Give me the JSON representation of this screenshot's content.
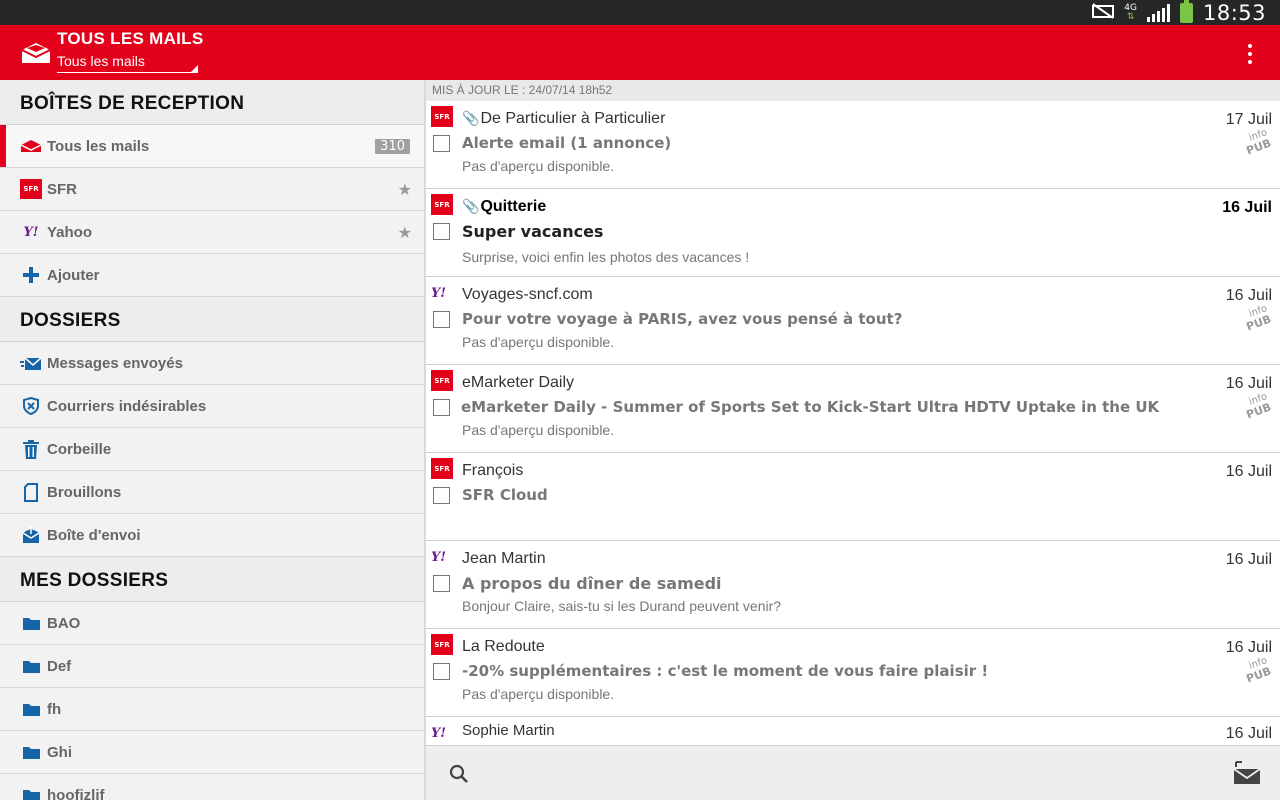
{
  "status": {
    "time": "18:53",
    "network": "4G"
  },
  "header": {
    "title": "TOUS LES MAILS",
    "subtitle": "Tous les mails"
  },
  "sidebar": {
    "inbox_title": "BOÎTES DE RECEPTION",
    "inbox_items": [
      {
        "label": "Tous les mails",
        "count": "310"
      },
      {
        "label": "SFR",
        "logo": "SFR"
      },
      {
        "label": "Yahoo",
        "logo": "Y!"
      },
      {
        "label": "Ajouter"
      }
    ],
    "folders_title": "DOSSIERS",
    "folders": [
      {
        "label": "Messages envoyés"
      },
      {
        "label": "Courriers indésirables"
      },
      {
        "label": "Corbeille"
      },
      {
        "label": "Brouillons"
      },
      {
        "label": "Boîte d'envoi"
      }
    ],
    "my_folders_title": "MES DOSSIERS",
    "my_folders": [
      {
        "label": "BAO"
      },
      {
        "label": "Def"
      },
      {
        "label": "fh"
      },
      {
        "label": "Ghi"
      },
      {
        "label": "hoofizlif"
      }
    ]
  },
  "list": {
    "updated": "MIS À JOUR LE : 24/07/14 18h52",
    "pub_info": "info",
    "pub_label": "PUB",
    "messages": [
      {
        "source": "SFR",
        "sender": "De Particulier à Particulier",
        "subject": "Alerte email (1 annonce)",
        "preview": "Pas d'aperçu disponible.",
        "date": "17 Juil"
      },
      {
        "source": "SFR",
        "sender": "Quitterie",
        "subject": "Super vacances",
        "preview": "Surprise, voici enfin les photos des vacances !",
        "date": "16 Juil"
      },
      {
        "source": "Y!",
        "sender": "Voyages-sncf.com",
        "subject": "Pour votre voyage à PARIS, avez vous pensé à tout?",
        "preview": "Pas d'aperçu disponible.",
        "date": "16 Juil"
      },
      {
        "source": "SFR",
        "sender": "eMarketer Daily",
        "subject": "eMarketer Daily - Summer of Sports Set to Kick-Start Ultra HDTV Uptake in the UK",
        "preview": "Pas d'aperçu disponible.",
        "date": "16 Juil"
      },
      {
        "source": "SFR",
        "sender": "François",
        "subject": "SFR Cloud",
        "preview": "",
        "date": "16 Juil"
      },
      {
        "source": "Y!",
        "sender": "Jean Martin",
        "subject": "A propos du dîner de samedi",
        "preview": "Bonjour Claire, sais-tu si les Durand peuvent venir?",
        "date": "16 Juil"
      },
      {
        "source": "SFR",
        "sender": "La Redoute",
        "subject": "-20% supplémentaires : c'est le moment de vous faire plaisir !",
        "preview": "Pas d'aperçu disponible.",
        "date": "16 Juil"
      },
      {
        "source": "Y!",
        "sender": "Sophie Martin",
        "subject": "",
        "preview": "",
        "date": "16 Juil"
      }
    ]
  },
  "colors": {
    "brand": "#e2001a",
    "yahoo": "#6a1b8a",
    "folder": "#1565a8"
  }
}
